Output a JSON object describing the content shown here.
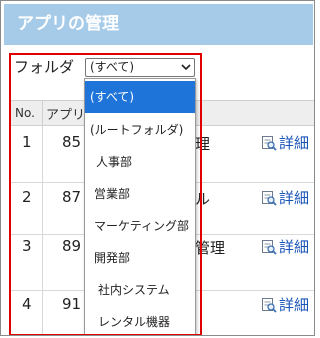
{
  "header": {
    "title": "アプリの管理"
  },
  "folder": {
    "label": "フォルダ",
    "selected": "(すべて)"
  },
  "dropdown": {
    "options": [
      "(すべて)",
      "(ルートフォルダ)",
      "人事部",
      "営業部",
      "マーケティング部",
      "開発部",
      "社内システム",
      "レンタル機器"
    ]
  },
  "table": {
    "headers": {
      "no": "No.",
      "id": "アプリ"
    },
    "rows": [
      {
        "no": "1",
        "id": "85",
        "name": "理",
        "detail": "詳細"
      },
      {
        "no": "2",
        "id": "87",
        "name": "ル",
        "detail": "詳細"
      },
      {
        "no": "3",
        "id": "89",
        "name": "管理",
        "detail": "詳細"
      },
      {
        "no": "4",
        "id": "91",
        "name": "",
        "detail": "詳細"
      }
    ]
  },
  "colors": {
    "header_bg": "#a6cbe9",
    "highlight": "#1e74d8",
    "outline": "#e00000",
    "link": "#1a55b8"
  },
  "icons": {
    "detail": "magnifier-doc-icon",
    "select_caret": "chevron-down-icon"
  }
}
